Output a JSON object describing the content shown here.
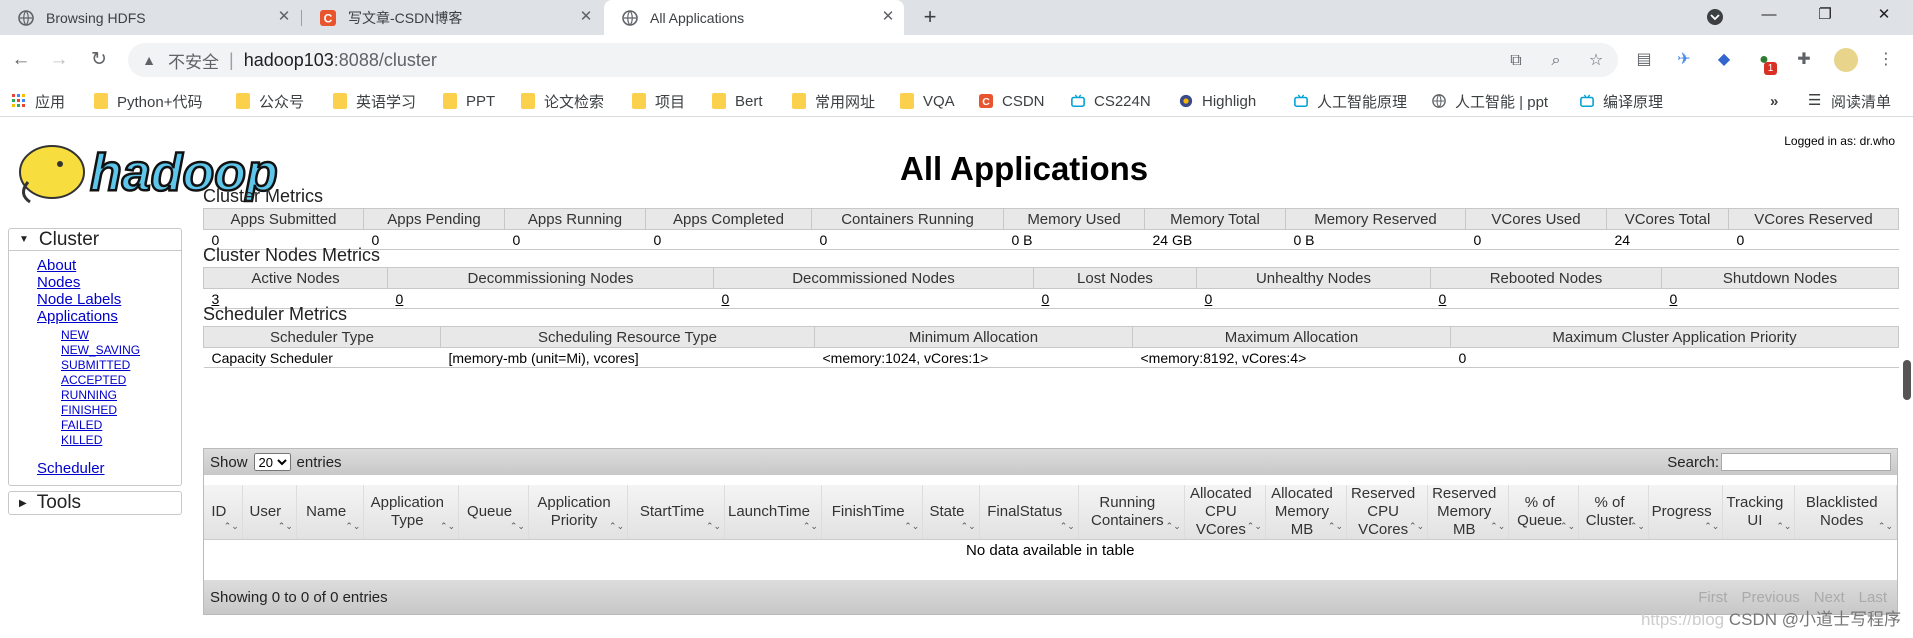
{
  "browser": {
    "tabs": [
      {
        "title": "Browsing HDFS",
        "active": false
      },
      {
        "title": "写文章-CSDN博客",
        "active": false
      },
      {
        "title": "All Applications",
        "active": true
      }
    ],
    "insecure_label": "不安全",
    "url_host": "hadoop103",
    "url_path": ":8088/cluster",
    "ext_badge": "1",
    "bookmarks": [
      "应用",
      "Python+代码",
      "公众号",
      "英语学习",
      "PPT",
      "论文检索",
      "项目",
      "Bert",
      "常用网址",
      "VQA",
      "CSDN",
      "CS224N",
      "Highligh",
      "人工智能原理",
      "人工智能 | ppt",
      "编译原理"
    ],
    "bookmarks_more": "»",
    "reading_list": "阅读清单"
  },
  "page": {
    "logged_in": "Logged in as: dr.who",
    "title": "All Applications",
    "logo_text": "hadoop"
  },
  "nav": {
    "cluster": "Cluster",
    "links": [
      "About",
      "Nodes",
      "Node Labels",
      "Applications"
    ],
    "app_states": [
      "NEW",
      "NEW_SAVING",
      "SUBMITTED",
      "ACCEPTED",
      "RUNNING",
      "FINISHED",
      "FAILED",
      "KILLED"
    ],
    "scheduler": "Scheduler",
    "tools": "Tools"
  },
  "cluster_metrics": {
    "title": "Cluster Metrics",
    "headers": [
      "Apps Submitted",
      "Apps Pending",
      "Apps Running",
      "Apps Completed",
      "Containers Running",
      "Memory Used",
      "Memory Total",
      "Memory Reserved",
      "VCores Used",
      "VCores Total",
      "VCores Reserved"
    ],
    "values": [
      "0",
      "0",
      "0",
      "0",
      "0",
      "0 B",
      "24 GB",
      "0 B",
      "0",
      "24",
      "0"
    ]
  },
  "nodes_metrics": {
    "title": "Cluster Nodes Metrics",
    "headers": [
      "Active Nodes",
      "Decommissioning Nodes",
      "Decommissioned Nodes",
      "Lost Nodes",
      "Unhealthy Nodes",
      "Rebooted Nodes",
      "Shutdown Nodes"
    ],
    "values": [
      "3",
      "0",
      "0",
      "0",
      "0",
      "0",
      "0"
    ]
  },
  "scheduler_metrics": {
    "title": "Scheduler Metrics",
    "headers": [
      "Scheduler Type",
      "Scheduling Resource Type",
      "Minimum Allocation",
      "Maximum Allocation",
      "Maximum Cluster Application Priority"
    ],
    "values": [
      "Capacity Scheduler",
      "[memory-mb (unit=Mi), vcores]",
      "<memory:1024, vCores:1>",
      "<memory:8192, vCores:4>",
      "0"
    ]
  },
  "apps_table": {
    "show": "Show",
    "page_size": "20",
    "entries": "entries",
    "search": "Search:",
    "columns": [
      [
        "ID"
      ],
      [
        "User"
      ],
      [
        "Name"
      ],
      [
        "Application",
        "Type"
      ],
      [
        "Queue"
      ],
      [
        "Application",
        "Priority"
      ],
      [
        "StartTime"
      ],
      [
        "LaunchTime"
      ],
      [
        "FinishTime"
      ],
      [
        "State"
      ],
      [
        "FinalStatus"
      ],
      [
        "Running",
        "Containers"
      ],
      [
        "Allocated",
        "CPU",
        "VCores"
      ],
      [
        "Allocated",
        "Memory",
        "MB"
      ],
      [
        "Reserved",
        "CPU",
        "VCores"
      ],
      [
        "Reserved",
        "Memory",
        "MB"
      ],
      [
        "% of",
        "Queue"
      ],
      [
        "% of",
        "Cluster"
      ],
      [
        "Progress"
      ],
      [
        "Tracking",
        "UI"
      ],
      [
        "Blacklisted",
        "Nodes"
      ]
    ],
    "empty": "No data available in table",
    "info": "Showing 0 to 0 of 0 entries",
    "pager": [
      "First",
      "Previous",
      "Next",
      "Last"
    ]
  },
  "watermark": {
    "faint": "https://blog",
    "text": "CSDN @小道士写程序"
  }
}
